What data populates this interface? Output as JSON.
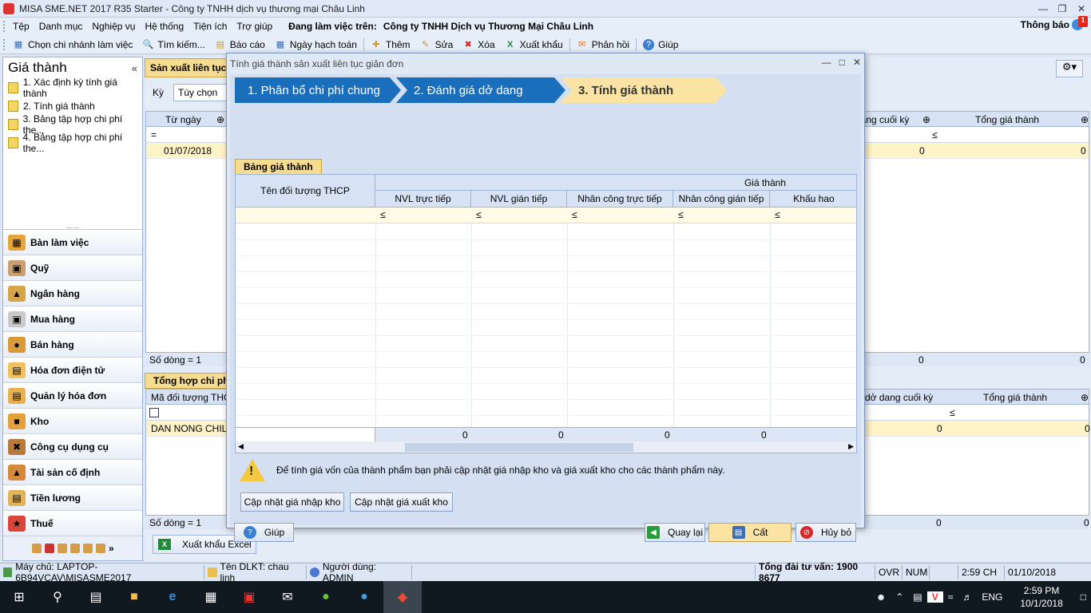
{
  "window": {
    "title": "MISA SME.NET 2017 R35 Starter - Công ty TNHH dịch vụ thương mại Châu Linh"
  },
  "menu": {
    "items": [
      "Tệp",
      "Danh mục",
      "Nghiệp vụ",
      "Hệ thống",
      "Tiện ích",
      "Trợ giúp"
    ],
    "working_label": "Đang làm việc trên:",
    "working_company": "Công ty TNHH Dịch vụ Thương Mại Châu Linh",
    "notifications_label": "Thông báo",
    "notifications_count": "1"
  },
  "toolbar": {
    "branch": "Chọn chi nhánh làm việc",
    "search": "Tìm kiếm...",
    "report": "Báo cáo",
    "posting_date": "Ngày hạch toán",
    "add": "Thêm",
    "edit": "Sửa",
    "delete": "Xóa",
    "export": "Xuất khẩu",
    "feedback": "Phản hồi",
    "help": "Giúp"
  },
  "leftnav": {
    "title": "Giá thành",
    "collapse": "«",
    "items": [
      "1. Xác định kỳ tính giá thành",
      "2. Tính giá thành",
      "3. Bảng tập hợp chi phí the...",
      "4. Bảng tập hợp chi phí the..."
    ],
    "splitter": "........",
    "modules": [
      "Bàn làm việc",
      "Quỹ",
      "Ngân hàng",
      "Mua hàng",
      "Bán hàng",
      "Hóa đơn điện tử",
      "Quản lý hóa đơn",
      "Kho",
      "Công cụ dụng cụ",
      "Tài sản cố định",
      "Tiền lương",
      "Thuế"
    ],
    "more": "»"
  },
  "main": {
    "tab": "Sản xuất liên tục",
    "ky_label": "Kỳ",
    "ky_value": "Tùy chọn",
    "grid1": {
      "headers": {
        "from_date": "Từ ngày",
        "wip_end": "dang cuối kỳ",
        "total_cost": "Tổng giá thành"
      },
      "filter_eq": "=",
      "filter_le": "≤",
      "row": {
        "from_date": "01/07/2018",
        "wip_end": "0",
        "total_cost": "0"
      },
      "footer_count": "Số dòng = 1",
      "footer_wip": "0",
      "footer_total": "0"
    },
    "tab2": "Tổng hợp chi phí",
    "grid2": {
      "headers": {
        "code": "Mã đối tượng THCP",
        "wip_end": "dở dang cuối kỳ",
        "total_cost": "Tổng giá thành"
      },
      "filter_le": "≤",
      "row": {
        "code": "DAN NONG CHILL",
        "wip_end": "0",
        "total_cost": "0"
      },
      "footer_count": "Số dòng = 1",
      "footer_wip": "0",
      "footer_total": "0"
    },
    "export_button": "Xuất khẩu Excel"
  },
  "dialog": {
    "title": "Tính giá thành sản xuất liên tục giản đơn",
    "steps": [
      "1. Phân bổ chi phí chung",
      "2. Đánh giá dở dang",
      "3. Tính giá thành"
    ],
    "tab": "Bảng giá thành",
    "grid": {
      "col_object": "Tên đối tượng THCP",
      "group": "Giá thành",
      "columns": [
        "NVL trực tiếp",
        "NVL gián tiếp",
        "Nhân công trực tiếp",
        "Nhân công gián tiếp",
        "Khấu hao"
      ],
      "filter_le": "≤",
      "sums": [
        "0",
        "0",
        "0",
        "0"
      ]
    },
    "warning": "Để tính giá vốn của thành phẩm bạn phải cập nhật giá nhập kho và giá xuất kho cho các thành phẩm này.",
    "btn_update_in": "Cập nhật giá nhập kho",
    "btn_update_out": "Cập nhật giá xuất kho",
    "btn_help": "Giúp",
    "btn_back": "Quay lại",
    "btn_save": "Cất",
    "btn_cancel": "Hủy bỏ"
  },
  "statusbar": {
    "server": "Máy chủ: LAPTOP-6B94VCAV\\MISASME2017",
    "dataset": "Tên DLKT: chau linh",
    "user": "Người dùng: ADMIN",
    "hotline": "Tổng đài tư vấn: 1900 8677",
    "ovr": "OVR",
    "num": "NUM",
    "time": "2:59 CH",
    "date": "01/10/2018"
  },
  "taskbar": {
    "lang": "ENG",
    "time": "2:59 PM",
    "date": "10/1/2018"
  }
}
